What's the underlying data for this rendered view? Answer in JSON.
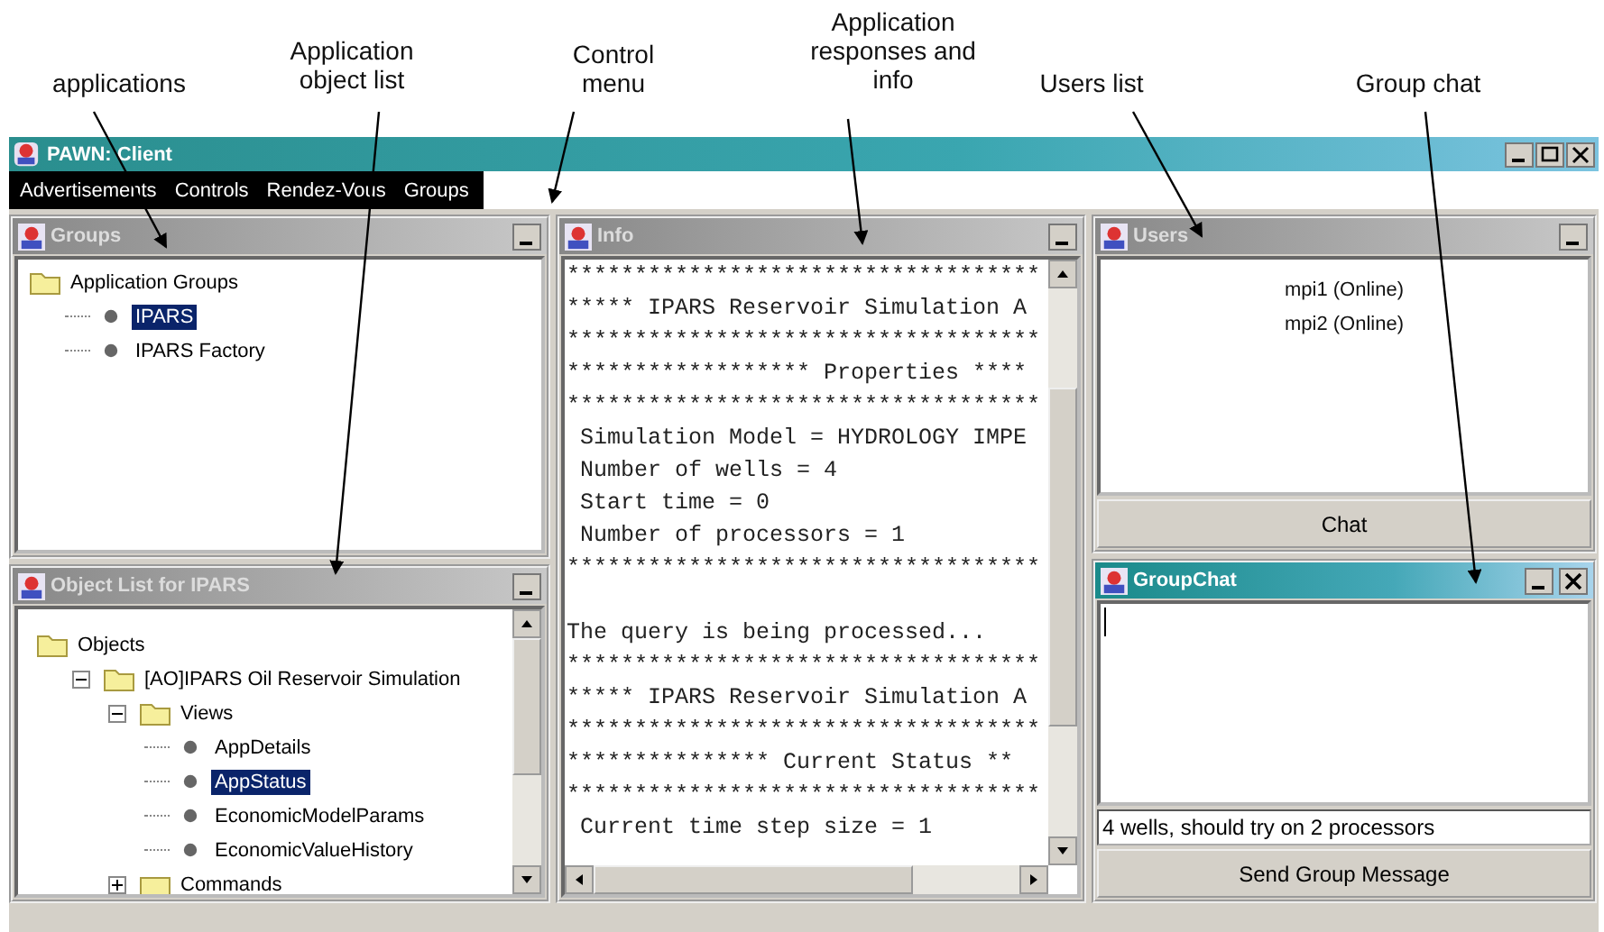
{
  "annotations": [
    {
      "text": "applications"
    },
    {
      "text": "Application object list"
    },
    {
      "text": "Control menu"
    },
    {
      "text": "Application responses and info"
    },
    {
      "text": "Users list"
    },
    {
      "text": "Group chat"
    }
  ],
  "window": {
    "title": "PAWN: Client"
  },
  "menu": [
    "Advertisements",
    "Controls",
    "Rendez-Vous",
    "Groups"
  ],
  "groups_panel": {
    "title": "Groups",
    "active": false,
    "tree": [
      {
        "label": "Application Groups",
        "kind": "folder",
        "expanded": true,
        "selected": false,
        "children": [
          {
            "label": "IPARS",
            "kind": "leaf",
            "selected": true
          },
          {
            "label": "IPARS Factory",
            "kind": "leaf",
            "selected": false
          }
        ]
      }
    ]
  },
  "object_panel": {
    "title": "Object List for IPARS",
    "active": false,
    "tree": [
      {
        "label": "Objects",
        "kind": "folder",
        "expanded": true,
        "selected": false,
        "children": [
          {
            "label": "[AO]IPARS Oil Reservoir Simulation",
            "kind": "folder",
            "expanded": true,
            "selected": false,
            "children": [
              {
                "label": "Views",
                "kind": "folder",
                "expanded": true,
                "selected": false,
                "children": [
                  {
                    "label": "AppDetails",
                    "kind": "leaf",
                    "selected": false
                  },
                  {
                    "label": "AppStatus",
                    "kind": "leaf",
                    "selected": true
                  },
                  {
                    "label": "EconomicModelParams",
                    "kind": "leaf",
                    "selected": false
                  },
                  {
                    "label": "EconomicValueHistory",
                    "kind": "leaf",
                    "selected": false
                  }
                ]
              },
              {
                "label": "Commands",
                "kind": "folder",
                "expanded": false,
                "selected": false
              }
            ]
          }
        ]
      }
    ]
  },
  "info_panel": {
    "title": "Info",
    "active": false,
    "blocks": [
      [
        "***********************************",
        "***** IPARS Reservoir Simulation A",
        "***********************************",
        "****************** Properties ****",
        "***********************************",
        " Simulation Model = HYDROLOGY IMPE",
        " Number of wells = 4",
        " Start time = 0",
        " Number of processors = 1",
        "***********************************"
      ],
      [
        "The query is being processed...",
        "***********************************",
        "***** IPARS Reservoir Simulation A",
        "***********************************",
        "*************** Current Status **",
        "***********************************",
        " Current time step size = 1"
      ]
    ]
  },
  "users_panel": {
    "title": "Users",
    "active": false,
    "users": [
      "mpi1 (Online)",
      "mpi2 (Online)"
    ],
    "button": "Chat"
  },
  "chat_panel": {
    "title": "GroupChat",
    "active": true,
    "closable": true,
    "message": "4 wells, should try on 2 processors",
    "button": "Send Group Message"
  }
}
